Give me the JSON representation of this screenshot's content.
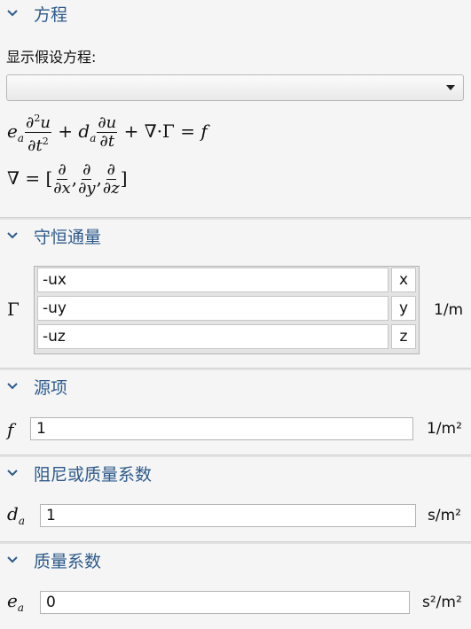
{
  "sections": {
    "equation": {
      "title": "方程"
    },
    "conservative_flux": {
      "title": "守恒通量"
    },
    "source": {
      "title": "源项"
    },
    "damping": {
      "title": "阻尼或质量系数"
    },
    "mass": {
      "title": "质量系数"
    }
  },
  "equation": {
    "show_label": "显示假设方程:",
    "combo_value": ""
  },
  "flux": {
    "symbol": "Γ",
    "rows": [
      {
        "value": "-ux",
        "component": "x"
      },
      {
        "value": "-uy",
        "component": "y"
      },
      {
        "value": "-uz",
        "component": "z"
      }
    ],
    "unit": "1/m"
  },
  "source": {
    "symbol": "f",
    "value": "1",
    "unit": "1/m²"
  },
  "damping": {
    "symbol": "d",
    "subscript": "a",
    "value": "1",
    "unit": "s/m²"
  },
  "mass": {
    "symbol": "e",
    "subscript": "a",
    "value": "0",
    "unit": "s²/m²"
  },
  "icons": {
    "collapse": "chevron-down-icon",
    "dropdown": "dropdown-arrow-icon"
  }
}
